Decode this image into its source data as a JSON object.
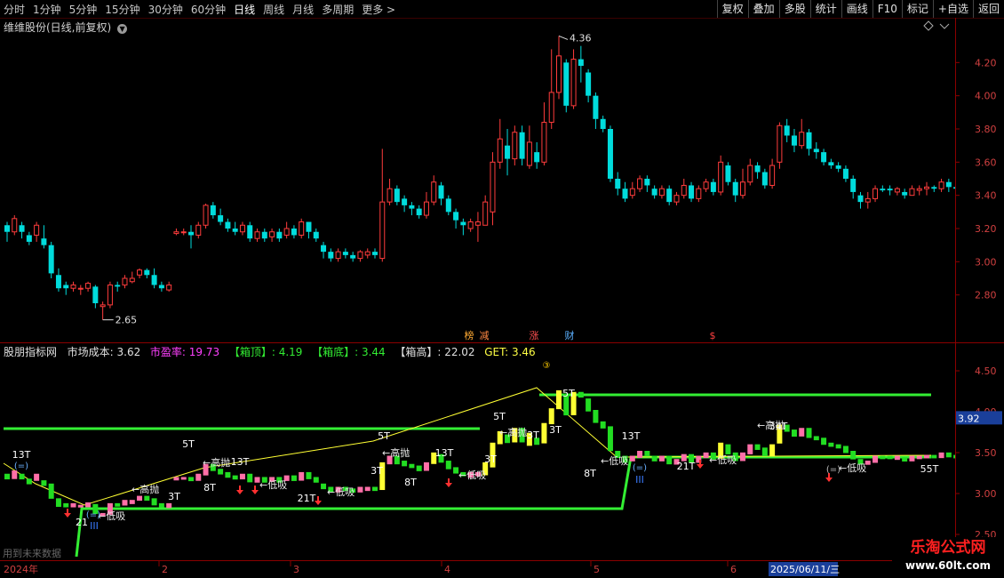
{
  "toolbar": {
    "periods": [
      "分时",
      "1分钟",
      "5分钟",
      "15分钟",
      "30分钟",
      "60分钟",
      "日线",
      "周线",
      "月线",
      "多周期",
      "更多 >"
    ],
    "active_period": "日线",
    "tools": [
      "复权",
      "叠加",
      "多股",
      "统计",
      "画线",
      "F10",
      "标记",
      "+自选",
      "返回"
    ]
  },
  "stock": {
    "title": "维维股份(日线,前复权)",
    "high_label": "4.36",
    "low_label": "2.65"
  },
  "price_axis": [
    "4.20",
    "4.00",
    "3.80",
    "3.60",
    "3.40",
    "3.20",
    "3.00",
    "2.80"
  ],
  "event_markers": [
    "榜",
    "减",
    "涨",
    "财",
    "$"
  ],
  "indicator": {
    "name": "股朋指标网",
    "market_cost_label": "市场成本:",
    "market_cost": "3.62",
    "pe_label": "市盈率:",
    "pe": "19.73",
    "box_top_label": "【箱顶】:",
    "box_top": "4.19",
    "box_bottom_label": "【箱底】:",
    "box_bottom": "3.44",
    "box_high_label": "【箱高】:",
    "box_high": "22.02",
    "get_label": "GET:",
    "get": "3.46",
    "axis": [
      "4.50",
      "4.00",
      "3.50",
      "3.00",
      "2.50"
    ],
    "current_tag": "3.92",
    "note": "用到未来数据"
  },
  "dates": {
    "year": "2024年",
    "months": [
      "2",
      "3",
      "4",
      "5",
      "6"
    ],
    "cursor": "2025/06/11/三"
  },
  "watermark": {
    "title": "乐淘公式网",
    "url": "www.60lt.com"
  },
  "colors": {
    "up": "#ff3c3c",
    "down": "#00dcdc",
    "green": "#33ee33",
    "yellow": "#ffff33",
    "frame": "#8b0000"
  },
  "chart_data": {
    "type": "candlestick",
    "ylim": [
      2.6,
      4.4
    ],
    "candles": [
      [
        3.22,
        3.18,
        3.24,
        3.12
      ],
      [
        3.18,
        3.26,
        3.28,
        3.16
      ],
      [
        3.22,
        3.18,
        3.24,
        3.14
      ],
      [
        3.16,
        3.12,
        3.18,
        3.1
      ],
      [
        3.16,
        3.22,
        3.24,
        3.12
      ],
      [
        3.14,
        3.1,
        3.22,
        3.08
      ],
      [
        3.1,
        2.93,
        3.12,
        2.9
      ],
      [
        2.92,
        2.84,
        2.96,
        2.82
      ],
      [
        2.86,
        2.84,
        2.88,
        2.8
      ],
      [
        2.84,
        2.86,
        2.88,
        2.82
      ],
      [
        2.84,
        2.84,
        2.86,
        2.8
      ],
      [
        2.84,
        2.87,
        2.88,
        2.82
      ],
      [
        2.85,
        2.75,
        2.86,
        2.72
      ],
      [
        2.73,
        2.74,
        2.76,
        2.65
      ],
      [
        2.74,
        2.86,
        2.88,
        2.72
      ],
      [
        2.86,
        2.85,
        2.88,
        2.82
      ],
      [
        2.86,
        2.9,
        2.92,
        2.84
      ],
      [
        2.88,
        2.9,
        2.94,
        2.87
      ],
      [
        2.92,
        2.95,
        2.96,
        2.9
      ],
      [
        2.95,
        2.92,
        2.96,
        2.9
      ],
      [
        2.92,
        2.86,
        2.96,
        2.84
      ],
      [
        2.86,
        2.84,
        2.88,
        2.82
      ],
      [
        2.83,
        2.86,
        2.88,
        2.82
      ],
      [
        3.17,
        3.18,
        3.2,
        3.16
      ],
      [
        3.18,
        3.18,
        3.2,
        3.16
      ],
      [
        3.18,
        3.16,
        3.22,
        3.08
      ],
      [
        3.16,
        3.22,
        3.24,
        3.14
      ],
      [
        3.22,
        3.34,
        3.35,
        3.2
      ],
      [
        3.34,
        3.28,
        3.36,
        3.26
      ],
      [
        3.28,
        3.24,
        3.32,
        3.22
      ],
      [
        3.24,
        3.2,
        3.26,
        3.18
      ],
      [
        3.2,
        3.18,
        3.24,
        3.16
      ],
      [
        3.18,
        3.22,
        3.24,
        3.16
      ],
      [
        3.22,
        3.14,
        3.24,
        3.12
      ],
      [
        3.14,
        3.18,
        3.2,
        3.12
      ],
      [
        3.18,
        3.14,
        3.2,
        3.12
      ],
      [
        3.15,
        3.18,
        3.2,
        3.12
      ],
      [
        3.18,
        3.14,
        3.2,
        3.12
      ],
      [
        3.16,
        3.2,
        3.24,
        3.14
      ],
      [
        3.2,
        3.16,
        3.22,
        3.14
      ],
      [
        3.16,
        3.24,
        3.26,
        3.14
      ],
      [
        3.24,
        3.18,
        3.24,
        3.14
      ],
      [
        3.18,
        3.14,
        3.2,
        3.12
      ],
      [
        3.1,
        3.06,
        3.12,
        3.02
      ],
      [
        3.06,
        3.02,
        3.08,
        3.0
      ],
      [
        3.02,
        3.06,
        3.08,
        3.0
      ],
      [
        3.06,
        3.04,
        3.08,
        3.02
      ],
      [
        3.04,
        3.02,
        3.06,
        3.0
      ],
      [
        3.02,
        3.06,
        3.07,
        3.0
      ],
      [
        3.04,
        3.06,
        3.08,
        3.02
      ],
      [
        3.06,
        3.04,
        3.08,
        3.02
      ],
      [
        3.02,
        3.36,
        3.68,
        3.0
      ],
      [
        3.36,
        3.44,
        3.5,
        3.34
      ],
      [
        3.44,
        3.36,
        3.46,
        3.34
      ],
      [
        3.38,
        3.34,
        3.4,
        3.3
      ],
      [
        3.34,
        3.32,
        3.36,
        3.28
      ],
      [
        3.32,
        3.28,
        3.34,
        3.26
      ],
      [
        3.28,
        3.36,
        3.42,
        3.26
      ],
      [
        3.36,
        3.48,
        3.52,
        3.34
      ],
      [
        3.46,
        3.38,
        3.48,
        3.34
      ],
      [
        3.38,
        3.3,
        3.4,
        3.28
      ],
      [
        3.3,
        3.25,
        3.32,
        3.2
      ],
      [
        3.24,
        3.22,
        3.26,
        3.16
      ],
      [
        3.2,
        3.24,
        3.26,
        3.18
      ],
      [
        3.22,
        3.24,
        3.3,
        3.12
      ],
      [
        3.22,
        3.36,
        3.4,
        3.22
      ],
      [
        3.3,
        3.6,
        3.66,
        3.22
      ],
      [
        3.6,
        3.74,
        3.86,
        3.56
      ],
      [
        3.7,
        3.62,
        3.8,
        3.52
      ],
      [
        3.62,
        3.78,
        3.82,
        3.58
      ],
      [
        3.78,
        3.62,
        3.82,
        3.58
      ],
      [
        3.58,
        3.72,
        3.82,
        3.56
      ],
      [
        3.66,
        3.6,
        3.72,
        3.56
      ],
      [
        3.6,
        3.84,
        3.96,
        3.58
      ],
      [
        3.84,
        4.02,
        4.28,
        3.8
      ],
      [
        4.02,
        4.24,
        4.36,
        3.98
      ],
      [
        4.2,
        3.94,
        4.22,
        3.9
      ],
      [
        3.94,
        4.22,
        4.28,
        3.92
      ],
      [
        4.22,
        4.18,
        4.3,
        4.08
      ],
      [
        4.14,
        4.0,
        4.16,
        3.96
      ],
      [
        4.0,
        3.86,
        4.02,
        3.8
      ],
      [
        3.86,
        3.8,
        3.88,
        3.78
      ],
      [
        3.8,
        3.5,
        3.82,
        3.48
      ],
      [
        3.5,
        3.44,
        3.54,
        3.4
      ],
      [
        3.44,
        3.38,
        3.48,
        3.36
      ],
      [
        3.4,
        3.44,
        3.48,
        3.38
      ],
      [
        3.44,
        3.5,
        3.52,
        3.42
      ],
      [
        3.5,
        3.46,
        3.52,
        3.42
      ],
      [
        3.44,
        3.4,
        3.46,
        3.38
      ],
      [
        3.4,
        3.44,
        3.46,
        3.38
      ],
      [
        3.44,
        3.36,
        3.46,
        3.34
      ],
      [
        3.36,
        3.4,
        3.42,
        3.34
      ],
      [
        3.4,
        3.46,
        3.5,
        3.38
      ],
      [
        3.46,
        3.38,
        3.48,
        3.36
      ],
      [
        3.38,
        3.44,
        3.46,
        3.36
      ],
      [
        3.44,
        3.48,
        3.5,
        3.42
      ],
      [
        3.48,
        3.42,
        3.5,
        3.4
      ],
      [
        3.42,
        3.6,
        3.64,
        3.4
      ],
      [
        3.58,
        3.48,
        3.6,
        3.46
      ],
      [
        3.48,
        3.4,
        3.5,
        3.36
      ],
      [
        3.4,
        3.48,
        3.56,
        3.38
      ],
      [
        3.48,
        3.58,
        3.62,
        3.46
      ],
      [
        3.58,
        3.54,
        3.6,
        3.5
      ],
      [
        3.54,
        3.46,
        3.56,
        3.44
      ],
      [
        3.46,
        3.58,
        3.62,
        3.44
      ],
      [
        3.6,
        3.82,
        3.84,
        3.56
      ],
      [
        3.82,
        3.76,
        3.86,
        3.72
      ],
      [
        3.76,
        3.7,
        3.8,
        3.66
      ],
      [
        3.7,
        3.78,
        3.86,
        3.68
      ],
      [
        3.78,
        3.68,
        3.8,
        3.64
      ],
      [
        3.68,
        3.66,
        3.72,
        3.62
      ],
      [
        3.66,
        3.6,
        3.68,
        3.58
      ],
      [
        3.6,
        3.58,
        3.62,
        3.56
      ],
      [
        3.58,
        3.56,
        3.6,
        3.54
      ],
      [
        3.56,
        3.5,
        3.58,
        3.48
      ],
      [
        3.5,
        3.42,
        3.52,
        3.38
      ],
      [
        3.4,
        3.36,
        3.42,
        3.32
      ],
      [
        3.36,
        3.38,
        3.42,
        3.32
      ],
      [
        3.38,
        3.44,
        3.46,
        3.36
      ],
      [
        3.44,
        3.43,
        3.46,
        3.42
      ],
      [
        3.44,
        3.43,
        3.46,
        3.4
      ],
      [
        3.42,
        3.44,
        3.45,
        3.4
      ],
      [
        3.42,
        3.4,
        3.44,
        3.38
      ],
      [
        3.4,
        3.44,
        3.46,
        3.4
      ],
      [
        3.43,
        3.44,
        3.46,
        3.4
      ],
      [
        3.44,
        3.45,
        3.48,
        3.4
      ],
      [
        3.45,
        3.44,
        3.46,
        3.42
      ],
      [
        3.44,
        3.48,
        3.5,
        3.42
      ],
      [
        3.48,
        3.45,
        3.5,
        3.42
      ],
      [
        3.45,
        3.44,
        3.47,
        3.42
      ],
      [
        3.44,
        3.46,
        3.48,
        3.42
      ]
    ]
  }
}
